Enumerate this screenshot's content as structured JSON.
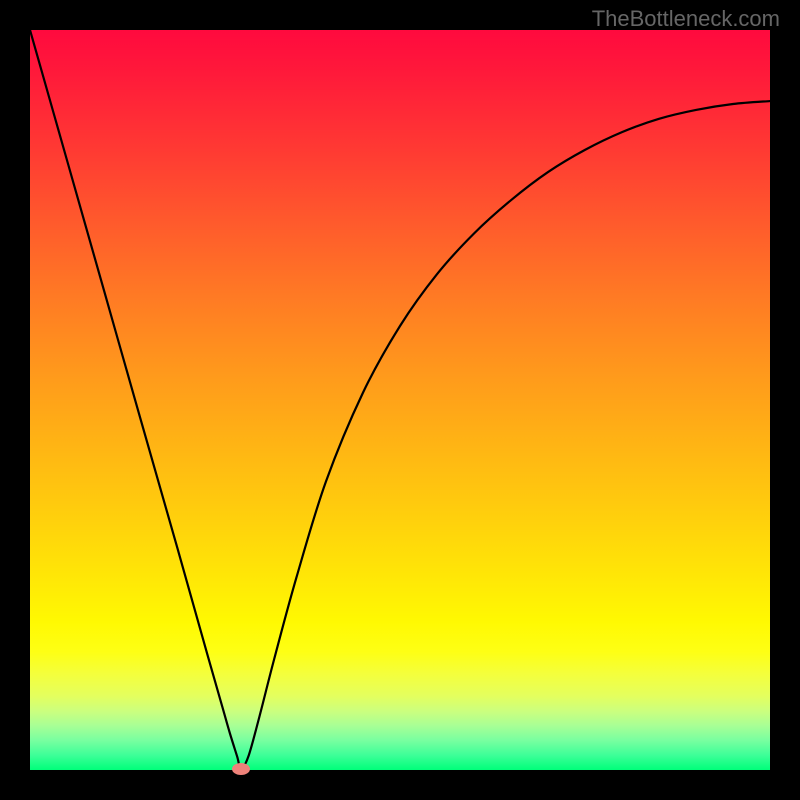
{
  "watermark": "TheBottleneck.com",
  "chart_data": {
    "type": "line",
    "title": "",
    "xlabel": "",
    "ylabel": "",
    "xlim": [
      0,
      1
    ],
    "ylim": [
      0,
      1
    ],
    "grid": false,
    "legend": false,
    "background": "red-yellow-green vertical gradient",
    "series": [
      {
        "name": "curve",
        "x": [
          0.0,
          0.05,
          0.1,
          0.15,
          0.2,
          0.24,
          0.26,
          0.27,
          0.28,
          0.285,
          0.295,
          0.31,
          0.33,
          0.36,
          0.4,
          0.45,
          0.5,
          0.55,
          0.6,
          0.65,
          0.7,
          0.75,
          0.8,
          0.85,
          0.9,
          0.95,
          1.0
        ],
        "y": [
          1.0,
          0.824,
          0.648,
          0.472,
          0.297,
          0.155,
          0.085,
          0.05,
          0.018,
          0.002,
          0.018,
          0.072,
          0.15,
          0.26,
          0.39,
          0.51,
          0.6,
          0.67,
          0.725,
          0.77,
          0.808,
          0.838,
          0.862,
          0.88,
          0.892,
          0.9,
          0.904
        ]
      }
    ],
    "marker": {
      "x": 0.285,
      "y": 0.002,
      "color": "#ee827a"
    }
  },
  "colors": {
    "frame": "#000000",
    "curve": "#000000",
    "marker": "#ee827a"
  }
}
